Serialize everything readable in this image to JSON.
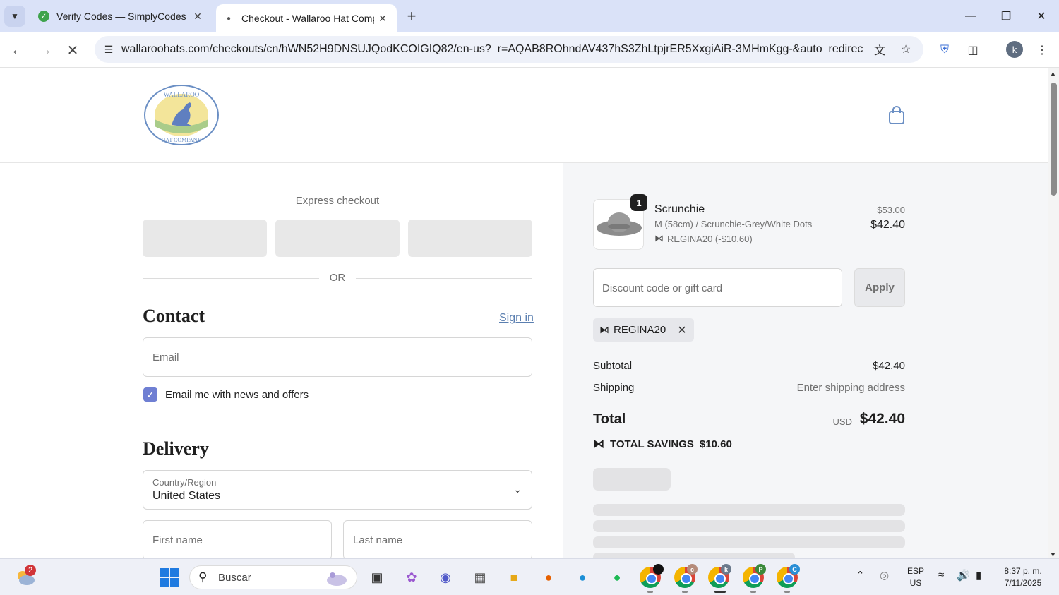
{
  "browser": {
    "tabs": [
      {
        "title": "Verify Codes — SimplyCodes",
        "active": false
      },
      {
        "title": "Checkout - Wallaroo Hat Comp",
        "active": true
      }
    ],
    "url": "wallaroohats.com/checkouts/cn/hWN52H9DNSUJQodKCOIGIQ82/en-us?_r=AQAB8ROhndAV437hS3ZhLtpjrER5XxgiAiR-3MHmKgg-&auto_redirect=false...",
    "profile_initial": "k"
  },
  "checkout": {
    "express_title": "Express checkout",
    "or_text": "OR",
    "contact_heading": "Contact",
    "sign_in_label": "Sign in",
    "email_placeholder": "Email",
    "news_opt_in_label": "Email me with news and offers",
    "delivery_heading": "Delivery",
    "country_label": "Country/Region",
    "country_value": "United States",
    "first_name_placeholder": "First name",
    "last_name_placeholder": "Last name"
  },
  "summary": {
    "item": {
      "quantity": "1",
      "name": "Scrunchie",
      "variant": "M (58cm) / Scrunchie-Grey/White Dots",
      "discount": "REGINA20 (-$10.60)",
      "price_original": "$53.00",
      "price_final": "$42.40"
    },
    "discount_placeholder": "Discount code or gift card",
    "apply_label": "Apply",
    "applied_code": "REGINA20",
    "subtotal_label": "Subtotal",
    "subtotal_value": "$42.40",
    "shipping_label": "Shipping",
    "shipping_value": "Enter shipping address",
    "total_label": "Total",
    "currency": "USD",
    "total_value": "$42.40",
    "savings_label": "TOTAL SAVINGS",
    "savings_value": "$10.60"
  },
  "taskbar": {
    "weather_badge": "2",
    "search_placeholder": "Buscar",
    "chrome_badges": [
      "c",
      "k",
      "P",
      "C"
    ],
    "lang_line1": "ESP",
    "lang_line2": "US",
    "time": "8:37 p. m.",
    "date": "7/11/2025"
  },
  "colors": {
    "accent_checkbox": "#6f7fd3",
    "link": "#5b7fb0",
    "summary_bg": "#f5f6f8"
  }
}
